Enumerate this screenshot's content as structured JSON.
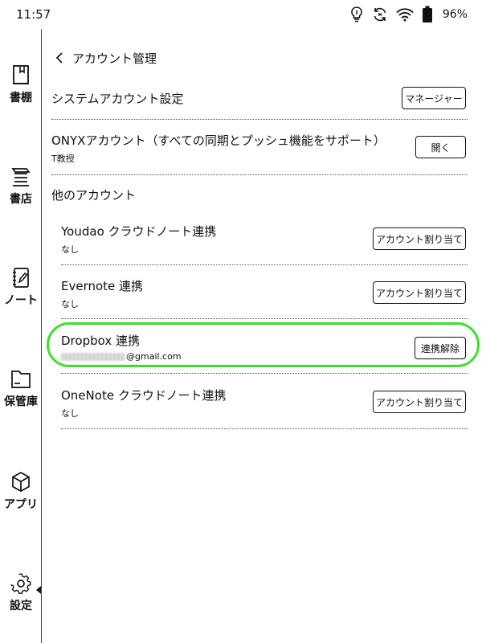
{
  "status_bar": {
    "time": "11:57",
    "battery": "96%",
    "icons": [
      "bulb-icon",
      "sync-icon",
      "wifi-icon",
      "battery-icon"
    ]
  },
  "sidebar": {
    "items": [
      {
        "label": "書棚",
        "icon": "bookshelf-icon"
      },
      {
        "label": "書店",
        "icon": "store-icon"
      },
      {
        "label": "ノート",
        "icon": "note-icon"
      },
      {
        "label": "保管庫",
        "icon": "folder-icon"
      },
      {
        "label": "アプリ",
        "icon": "apps-icon"
      },
      {
        "label": "設定",
        "icon": "gear-icon"
      }
    ]
  },
  "header": {
    "title": "アカウント管理"
  },
  "system_account": {
    "label": "システムアカウント設定",
    "button": "マネージャー"
  },
  "onyx_account": {
    "label": "ONYXアカウント（すべての同期とプッシュ機能をサポート）",
    "sub": "T教授",
    "button": "開く"
  },
  "other_accounts": {
    "heading": "他のアカウント",
    "youdao": {
      "label": "Youdao クラウドノート連携",
      "sub": "なし",
      "button": "アカウント割り当て"
    },
    "evernote": {
      "label": "Evernote 連携",
      "sub": "なし",
      "button": "アカウント割り当て"
    },
    "dropbox": {
      "label": "Dropbox 連携",
      "sub": "@gmail.com",
      "button": "連携解除"
    },
    "onenote": {
      "label": "OneNote クラウドノート連携",
      "sub": "なし",
      "button": "アカウント割り当て"
    }
  },
  "colors": {
    "highlight": "#38e22c",
    "text": "#111111",
    "background": "#ffffff"
  }
}
